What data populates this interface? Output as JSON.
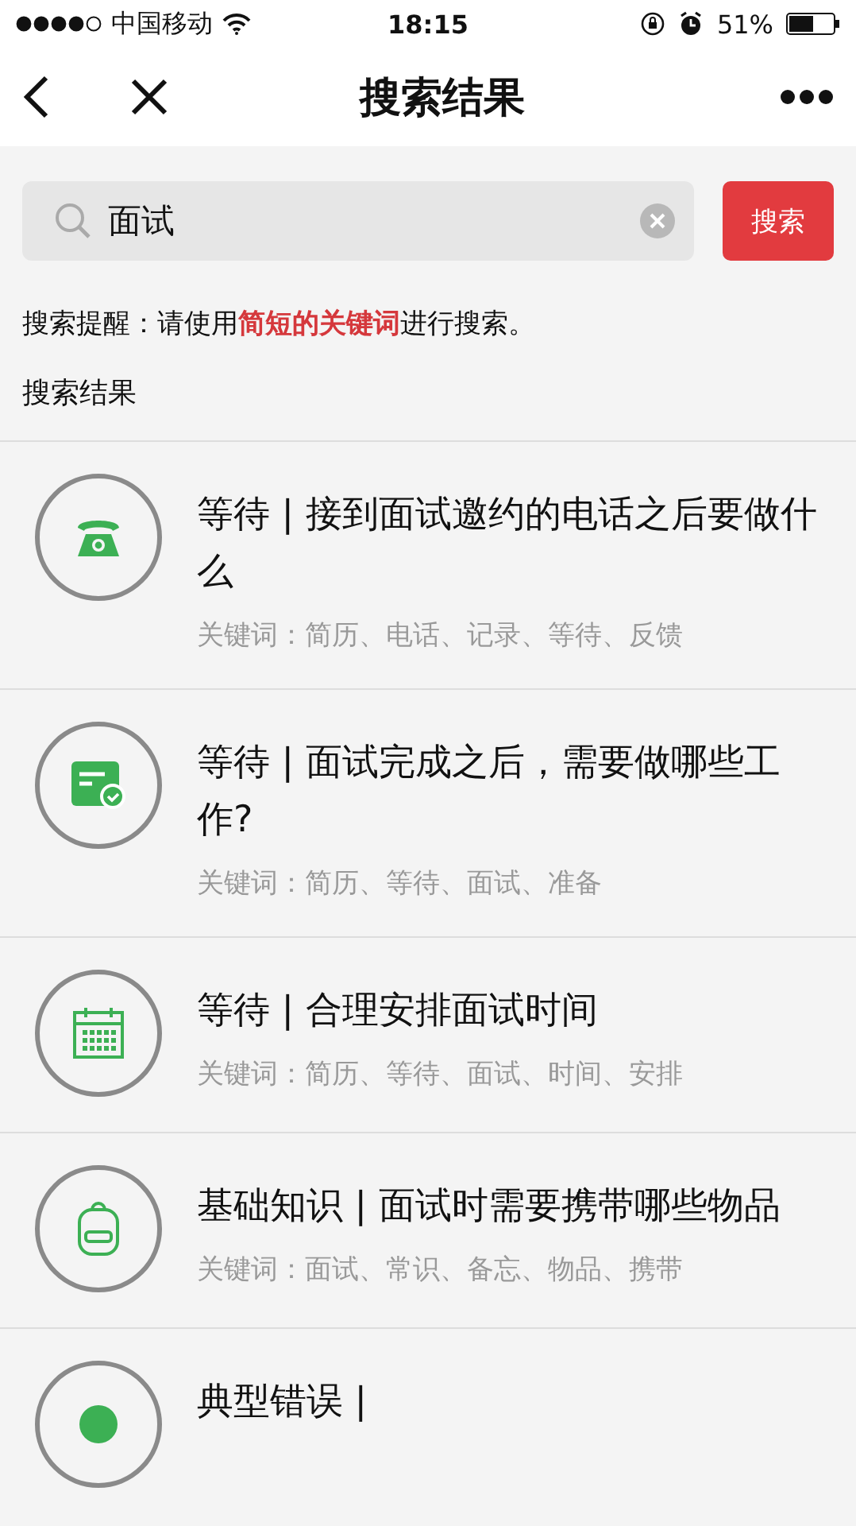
{
  "status_bar": {
    "carrier": "中国移动",
    "time": "18:15",
    "battery": "51%"
  },
  "nav": {
    "title": "搜索结果"
  },
  "search": {
    "value": "面试",
    "button": "搜索"
  },
  "hint": "搜索提醒：请使用**简短的关键词**进行搜索。",
  "section_title": "搜索结果",
  "results": [
    {
      "kind": "phone",
      "title": "等待 | 接到面试邀约的电话之后要做什么",
      "keywords": "关键词：简历、电话、记录、等待、反馈"
    },
    {
      "kind": "form",
      "title": "等待 | 面试完成之后，需要做哪些工作?",
      "keywords": "关键词：简历、等待、面试、准备"
    },
    {
      "kind": "calendar",
      "title": "等待 | 合理安排面试时间",
      "keywords": "关键词：简历、等待、面试、时间、安排"
    },
    {
      "kind": "backpack",
      "title": "基础知识 | 面试时需要携带哪些物品",
      "keywords": "关键词：面试、常识、备忘、物品、携带"
    },
    {
      "kind": "dot",
      "title": "典型错误 |"
    }
  ]
}
